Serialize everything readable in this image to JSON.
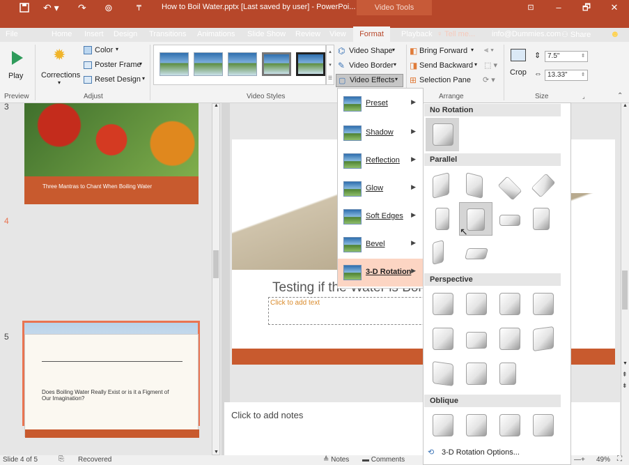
{
  "titlebar": {
    "doc_title": "How to Boil Water.pptx [Last saved by user] - PowerPoi...",
    "tools_label": "Video Tools",
    "save_icon": "save-icon",
    "undo_icon": "undo-icon",
    "redo_icon": "redo-icon",
    "present_icon": "present-icon",
    "minimize": "–",
    "restore": "🗗",
    "close": "✕"
  },
  "tabs": [
    "File",
    "Home",
    "Insert",
    "Design",
    "Transitions",
    "Animations",
    "Slide Show",
    "Review",
    "View",
    "Format",
    "Playback"
  ],
  "tell_me": "Tell me...",
  "user": "info@Dummies.com",
  "share": "Share",
  "ribbon": {
    "play": "Play",
    "corrections": "Corrections",
    "color": "Color",
    "poster_frame": "Poster Frame",
    "reset_design": "Reset Design",
    "video_shape": "Video Shape",
    "video_border": "Video Border",
    "video_effects": "Video Effects",
    "bring_forward": "Bring Forward",
    "send_backward": "Send Backward",
    "selection_pane": "Selection Pane",
    "crop": "Crop",
    "height": "7.5\"",
    "width": "13.33\"",
    "groups": {
      "preview": "Preview",
      "adjust": "Adjust",
      "video_styles": "Video Styles",
      "arrange": "Arrange",
      "size": "Size"
    }
  },
  "slides": {
    "n3": "3",
    "n4": "4",
    "n5": "5",
    "s3_caption": "Three Mantras to Chant When Boiling Water",
    "s5_text": "Does Boiling Water Really Exist or is it a Figment of Our Imagination?"
  },
  "main_slide": {
    "title": "Testing if the Water is Boi",
    "placeholder": "Click to add text"
  },
  "notes_placeholder": "Click to add notes",
  "status": {
    "slide": "Slide 4 of 5",
    "recovered": "Recovered",
    "notes": "Notes",
    "comments": "Comments",
    "zoom": "49%"
  },
  "effects_menu": [
    {
      "label": "Preset"
    },
    {
      "label": "Shadow"
    },
    {
      "label": "Reflection"
    },
    {
      "label": "Glow"
    },
    {
      "label": "Soft Edges"
    },
    {
      "label": "Bevel"
    },
    {
      "label": "3-D Rotation"
    }
  ],
  "gallery": {
    "no_rotation": "No Rotation",
    "parallel": "Parallel",
    "perspective": "Perspective",
    "oblique": "Oblique",
    "options": "3-D Rotation Options..."
  },
  "colors": {
    "accent": "#b7472a",
    "hover": "#fcd5c3"
  }
}
